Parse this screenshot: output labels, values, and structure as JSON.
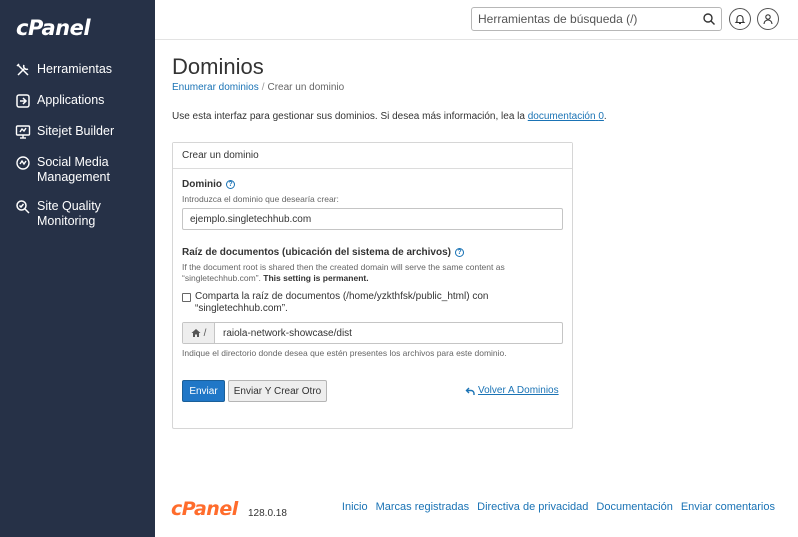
{
  "app": {
    "logo_text": "cPanel",
    "version": "128.0.18"
  },
  "sidebar": {
    "items": [
      {
        "label": "Herramientas",
        "icon": "tools-icon"
      },
      {
        "label": "Applications",
        "icon": "applications-icon"
      },
      {
        "label": "Sitejet Builder",
        "icon": "sitejet-icon"
      },
      {
        "label": "Social Media Management",
        "icon": "social-media-icon"
      },
      {
        "label": "Site Quality Monitoring",
        "icon": "site-quality-icon"
      }
    ]
  },
  "topbar": {
    "search_placeholder": "Herramientas de búsqueda (/)",
    "search_icon": "search-icon",
    "notifications_icon": "bell-icon",
    "user_icon": "user-icon"
  },
  "page": {
    "title": "Dominios",
    "breadcrumb": {
      "parent": "Enumerar dominios",
      "separator": "/",
      "current": "Crear un dominio"
    },
    "intro_text": "Use esta interfaz para gestionar sus dominios. Si desea más información, lea la ",
    "intro_link": "documentación",
    "intro_suffix": "."
  },
  "form": {
    "panel_title": "Crear un dominio",
    "domain": {
      "label": "Dominio",
      "help": "Introduzca el dominio que desearía crear:",
      "value": "ejemplo.singletechhub.com"
    },
    "docroot": {
      "label": "Raíz de documentos (ubicación del sistema de archivos)",
      "help_prefix": "If the document root is shared then the created domain will serve the same content as “singletechhub.com”. ",
      "help_bold": "This setting is permanent.",
      "checkbox_label": "Comparta la raíz de documentos (/home/yzkthfsk/public_html) con “singletechhub.com”.",
      "checkbox_checked": false,
      "addon_text": "/",
      "value": "raiola-network-showcase/dist",
      "footer_help": "Indique el directorio donde desea que estén presentes los archivos para este dominio."
    },
    "submit_label": "Enviar",
    "submit_another_label": "Enviar Y Crear Otro",
    "back_label": "Volver A Dominios"
  },
  "footer": {
    "links": [
      "Inicio",
      "Marcas registradas",
      "Directiva de privacidad",
      "Documentación",
      "Enviar comentarios"
    ]
  },
  "colors": {
    "sidebar_bg": "#263147",
    "link": "#1a73b5",
    "primary_button": "#2077c7",
    "footer_logo": "#ff6c2c"
  }
}
